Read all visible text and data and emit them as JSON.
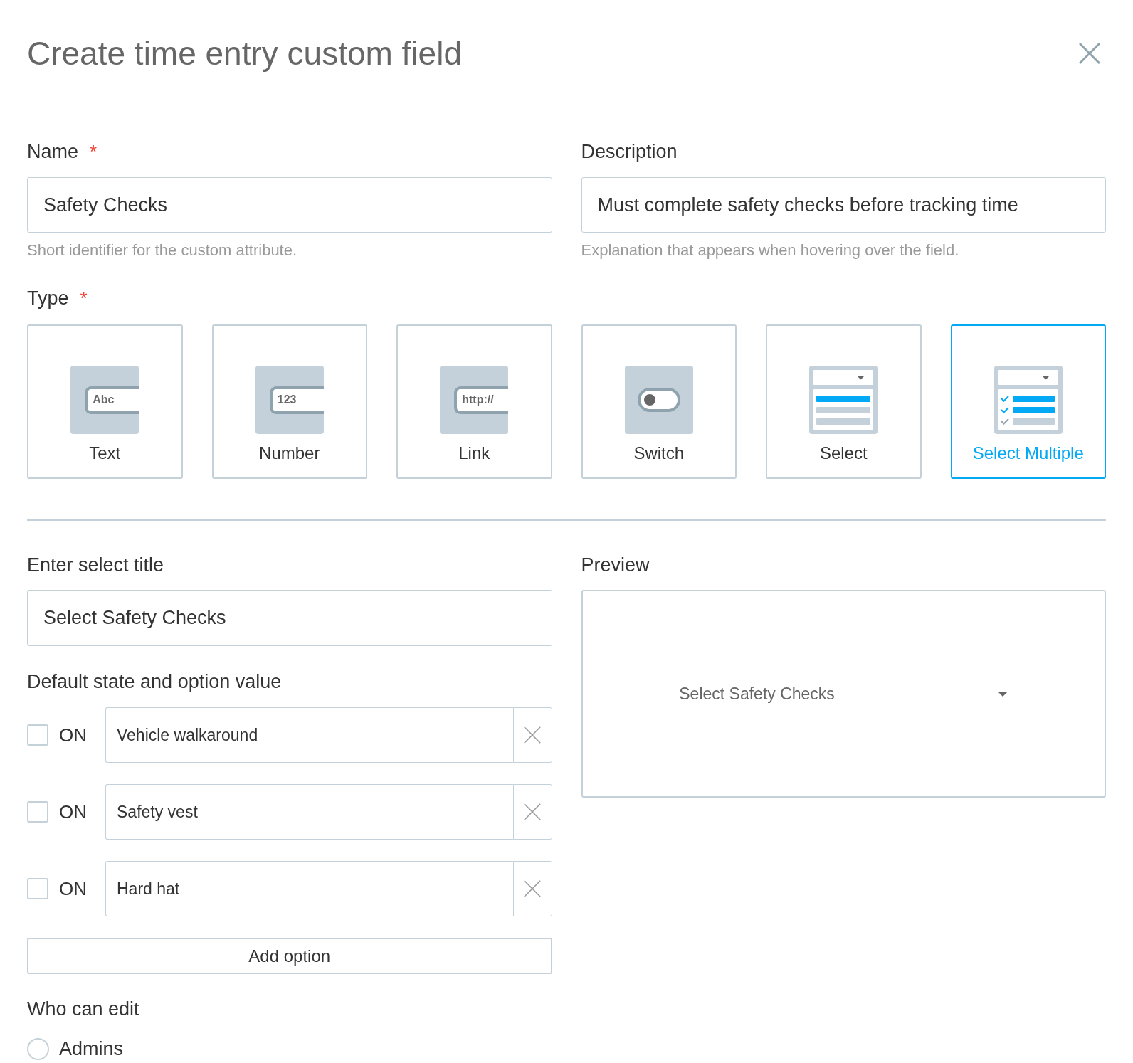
{
  "dialog": {
    "title": "Create time entry custom field"
  },
  "name_field": {
    "label": "Name",
    "required_mark": "*",
    "value": "Safety Checks",
    "hint": "Short identifier for the custom attribute."
  },
  "description_field": {
    "label": "Description",
    "value": "Must complete safety checks before tracking time",
    "hint": "Explanation that appears when hovering over the field."
  },
  "type": {
    "label": "Type",
    "required_mark": "*",
    "options": [
      {
        "kind": "text",
        "icon_text": "Abc",
        "label": "Text",
        "selected": false
      },
      {
        "kind": "number",
        "icon_text": "123",
        "label": "Number",
        "selected": false
      },
      {
        "kind": "link",
        "icon_text": "http://",
        "label": "Link",
        "selected": false
      },
      {
        "kind": "switch",
        "label": "Switch",
        "selected": false
      },
      {
        "kind": "select",
        "label": "Select",
        "selected": false
      },
      {
        "kind": "select_multiple",
        "label": "Select Multiple",
        "selected": true
      }
    ]
  },
  "select_title": {
    "label": "Enter select title",
    "value": "Select Safety Checks"
  },
  "default_options": {
    "label": "Default state and option value",
    "options": [
      {
        "toggle_label": "ON",
        "checked": false,
        "value": "Vehicle walkaround"
      },
      {
        "toggle_label": "ON",
        "checked": false,
        "value": "Safety vest"
      },
      {
        "toggle_label": "ON",
        "checked": false,
        "value": "Hard hat"
      }
    ],
    "add_button": "Add option"
  },
  "preview": {
    "label": "Preview",
    "select_placeholder": "Select Safety Checks"
  },
  "who_can_edit": {
    "label": "Who can edit",
    "options": [
      {
        "label": "Admins",
        "selected": false
      }
    ]
  }
}
